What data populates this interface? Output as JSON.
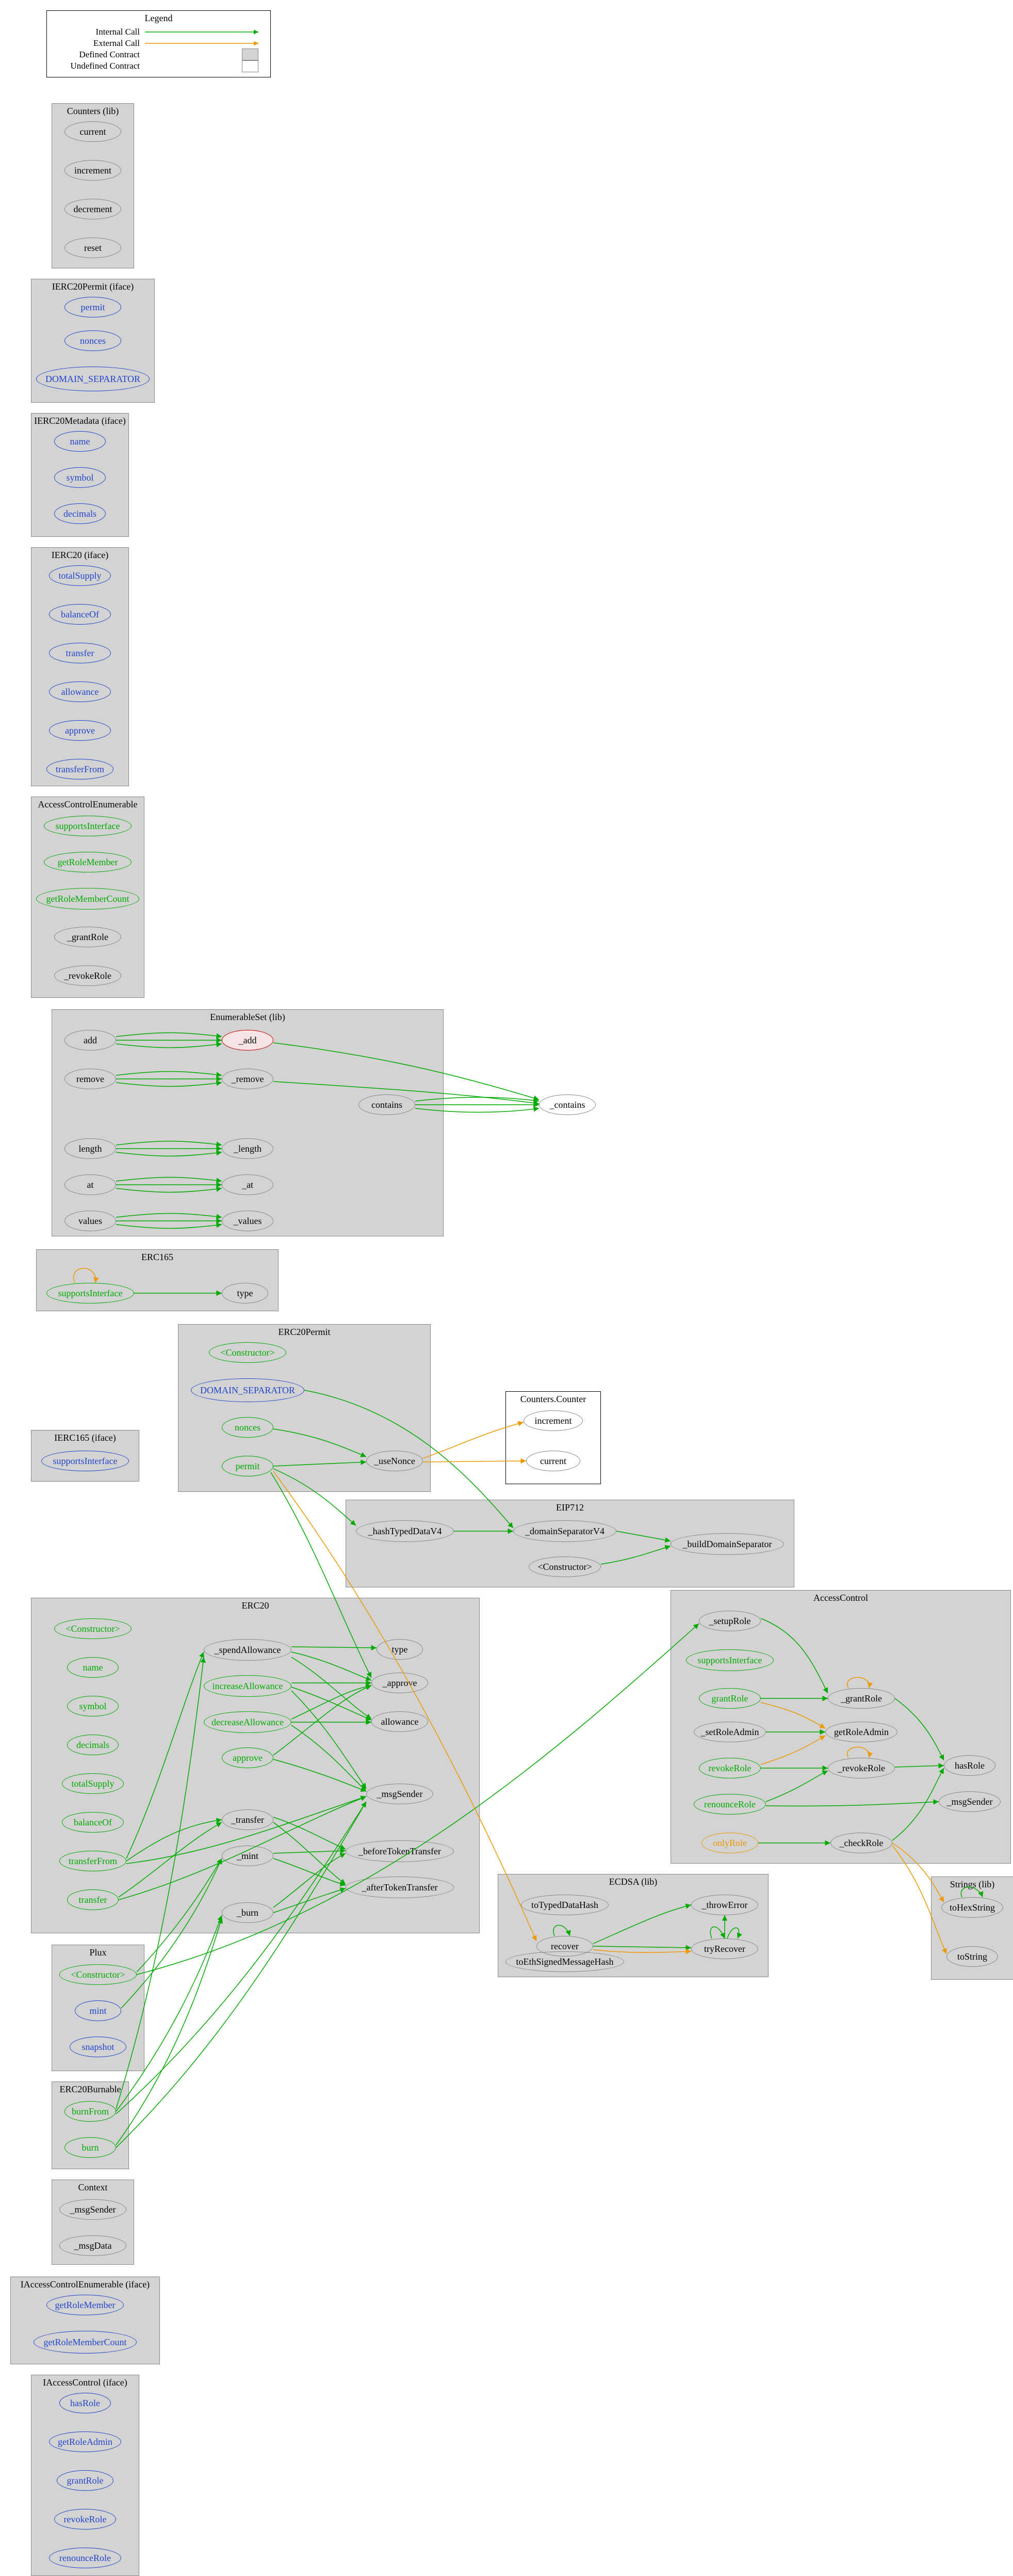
{
  "legend": {
    "title": "Legend",
    "internal": "Internal Call",
    "external": "External Call",
    "defined": "Defined Contract",
    "undefined": "Undefined Contract"
  },
  "clusters": {
    "counters": {
      "label": "Counters  (lib)"
    },
    "ierc20permit": {
      "label": "IERC20Permit  (iface)"
    },
    "ierc20meta": {
      "label": "IERC20Metadata  (iface)"
    },
    "ierc20": {
      "label": "IERC20  (iface)"
    },
    "ace": {
      "label": "AccessControlEnumerable"
    },
    "enumset": {
      "label": "EnumerableSet  (lib)"
    },
    "erc165": {
      "label": "ERC165"
    },
    "erc20permit": {
      "label": "ERC20Permit"
    },
    "counterscnt": {
      "label": "Counters.Counter"
    },
    "ierc165": {
      "label": "IERC165  (iface)"
    },
    "eip712": {
      "label": "EIP712"
    },
    "erc20": {
      "label": "ERC20"
    },
    "accesscontrol": {
      "label": "AccessControl"
    },
    "ecdsa": {
      "label": "ECDSA  (lib)"
    },
    "strings": {
      "label": "Strings  (lib)"
    },
    "plux": {
      "label": "Plux"
    },
    "erc20burn": {
      "label": "ERC20Burnable"
    },
    "context": {
      "label": "Context"
    },
    "iace": {
      "label": "IAccessControlEnumerable  (iface)"
    },
    "iac": {
      "label": "IAccessControl  (iface)"
    }
  },
  "nodes": {
    "counters_current": "current",
    "counters_increment": "increment",
    "counters_decrement": "decrement",
    "counters_reset": "reset",
    "ip_permit": "permit",
    "ip_nonces": "nonces",
    "ip_domain": "DOMAIN_SEPARATOR",
    "im_name": "name",
    "im_symbol": "symbol",
    "im_decimals": "decimals",
    "i20_totalSupply": "totalSupply",
    "i20_balanceOf": "balanceOf",
    "i20_transfer": "transfer",
    "i20_allowance": "allowance",
    "i20_approve": "approve",
    "i20_transferFrom": "transferFrom",
    "ace_supports": "supportsInterface",
    "ace_getRoleMember": "getRoleMember",
    "ace_getRoleMemberCount": "getRoleMemberCount",
    "ace_grantRole": "_grantRole",
    "ace_revokeRole": "_revokeRole",
    "es_add": "add",
    "es__add": "_add",
    "es_remove": "remove",
    "es__remove": "_remove",
    "es_contains": "contains",
    "es__contains": "_contains",
    "es_length": "length",
    "es__length": "_length",
    "es_at": "at",
    "es__at": "_at",
    "es_values": "values",
    "es__values": "_values",
    "e165_supports": "supportsInterface",
    "e165_type": "type",
    "ep_ctor": "<Constructor>",
    "ep_domain": "DOMAIN_SEPARATOR",
    "ep_nonces": "nonces",
    "ep_permit": "permit",
    "ep_useNonce": "_useNonce",
    "cc_increment": "increment",
    "cc_current": "current",
    "i165_supports": "supportsInterface",
    "eip_hash": "_hashTypedDataV4",
    "eip_domsep": "_domainSeparatorV4",
    "eip_build": "_buildDomainSeparator",
    "eip_ctor": "<Constructor>",
    "e20_ctor": "<Constructor>",
    "e20_name": "name",
    "e20_symbol": "symbol",
    "e20_decimals": "decimals",
    "e20_totalSupply": "totalSupply",
    "e20_balanceOf": "balanceOf",
    "e20_transferFrom": "transferFrom",
    "e20_transfer": "transfer",
    "e20_spendAllow": "_spendAllowance",
    "e20_incAllow": "increaseAllowance",
    "e20_decAllow": "decreaseAllowance",
    "e20_approve": "approve",
    "e20__approve": "_approve",
    "e20_allowance": "allowance",
    "e20_type": "type",
    "e20_msgSender": "_msgSender",
    "e20__transfer": "_transfer",
    "e20__mint": "_mint",
    "e20__burn": "_burn",
    "e20_before": "_beforeTokenTransfer",
    "e20_after": "_afterTokenTransfer",
    "ac_setupRole": "_setupRole",
    "ac_supports": "supportsInterface",
    "ac_grantRole": "grantRole",
    "ac__grantRole": "_grantRole",
    "ac_setRoleAdmin": "_setRoleAdmin",
    "ac_getRoleAdmin": "getRoleAdmin",
    "ac_revokeRole": "revokeRole",
    "ac__revokeRole": "_revokeRole",
    "ac_renounceRole": "renounceRole",
    "ac_hasRole": "hasRole",
    "ac_msgSender": "_msgSender",
    "ac_onlyRole": "onlyRole",
    "ac_checkRole": "_checkRole",
    "ecdsa_toTyped": "toTypedDataHash",
    "ecdsa_recover": "recover",
    "ecdsa_toEth": "toEthSignedMessageHash",
    "ecdsa_throw": "_throwError",
    "ecdsa_try": "tryRecover",
    "str_toHex": "toHexString",
    "str_toString": "toString",
    "plux_ctor": "<Constructor>",
    "plux_mint": "mint",
    "plux_snapshot": "snapshot",
    "burn_burnFrom": "burnFrom",
    "burn_burn": "burn",
    "ctx_msgSender": "_msgSender",
    "ctx_msgData": "_msgData",
    "iace_getRoleMember": "getRoleMember",
    "iace_getRoleMemberCount": "getRoleMemberCount",
    "iac_hasRole": "hasRole",
    "iac_getRoleAdmin": "getRoleAdmin",
    "iac_grantRole": "grantRole",
    "iac_revokeRole": "revokeRole",
    "iac_renounceRole": "renounceRole"
  }
}
